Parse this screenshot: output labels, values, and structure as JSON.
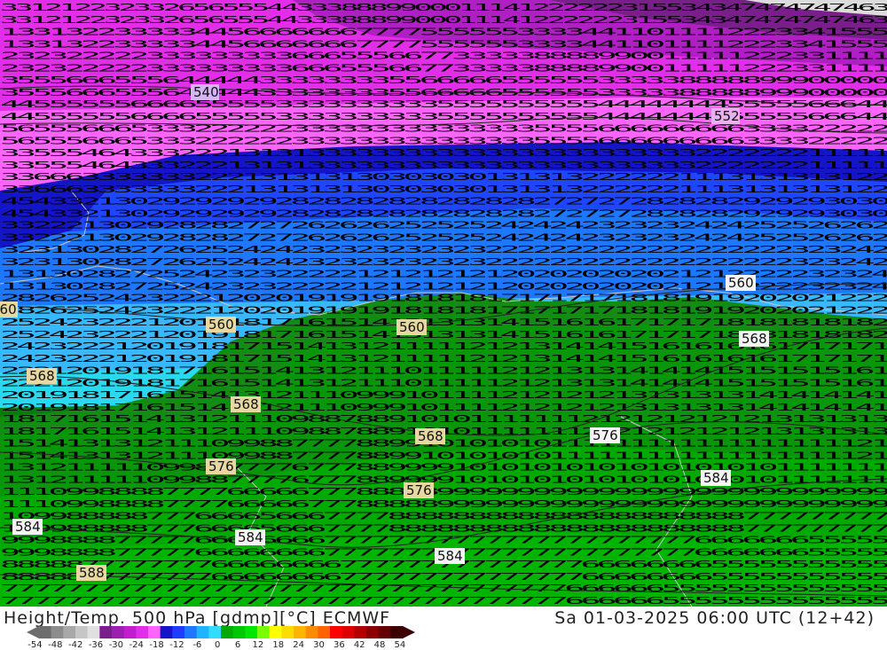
{
  "map": {
    "title": "Height/Temp. 500 hPa [gdmp][°C] ECMWF",
    "datetime": "Sa 01-03-2025 06:00 UTC (12+42)",
    "contour_labels": [
      "540",
      "552",
      "560",
      "560",
      "560",
      "560",
      "568",
      "568",
      "568",
      "568",
      "568",
      "576",
      "576",
      "576",
      "584",
      "584",
      "584",
      "584",
      "588"
    ],
    "grid_rows": [
      "33 1212 2323 32 6565 5 5 4 4 3 3 3 8 8 8 9 9 0 0 0 1 1 1 4 1 2 2 2 2 2 2 3 1 5 5 3 4 3 4 7 4 7 4 7 4 7 4 6 3",
      "1 3 3 1 3 2 2 3 3 3 3 3 4 4 5 6 6 6 6 6 6 6 7 7 7 7 5 5 5 5 5 5 3 3 3 3 4 4 1 1 0 1 1 1 1 2 2 2 3 3 4 1 5 5 5",
      "2 3 2 3 2 2 2 2 2 3 3 3 3 3 3 3 3 3 6 6 6 5 5 5 6 6 7 7 3 3 3 3 3 8 8 8 8 9 9 0 0 1 1 1 1 1 2 2 2 3 3 1 1 1 1",
      "3 5 5 5 6 6 6 5 5 5 6 4 4 4 4 4 3 3 3 3 3 3 3 3 5 5 6 6 6 6 6 5 5 5 5 5 5 3 3 3 3 3 8 8 8 8 8 9 9 9 0 0 0 0 0",
      "4 4 5 5 5 5 5 5 6 6 6 6 5 5 5 5 5 3 3 3 3 3 3 3 3 3 3 5 5 5 5 5 5 5 5 5 5 4 4 4 4 4 4 4 4 5 5 5 5 5 6 6 6 4 4",
      "5 6 5 5 5 6 6 6 5 3 3 3 2 2 2 2 2 2 3 3 3 3 3 3 3 3 3 3 3 3 3 3 3 5 5 5 5 6 6 6 6 6 6 6 6 6 3 3 3 3 2 2 2 2 2",
      "3 3 5 5 5 4 6 4 3 3 3 2 2 2 1 3 1 3 1 3 3 3 3 3 3 3 3 3 3 3 3 3 3 3 3 3 3 3 3 3 3 3 3 2 2 2 2 2 2 2 1 1 1 1 1",
      "3 3 6 6 6 3 3 3 3 3 3 3 2 2 2 1 3 1 3 1 3 1 3 0 3 0 3 0 3 0 1 3 1 3 1 3 2 2 2 2 2 2 1 1 1 3 1 3 1 3 1 3 1 2 2",
      "4 5 4 3 3 2 1 3 0 2 9 2 9 2 9 2 9 2 8 2 8 2 8 2 8 2 8 2 8 2 8 2 8 2 7 2 7 2 7 2 8 2 8 2 8 2 9 2 9 2 9 3 0 3 0",
      "3 3 2 2 2 1 3 0 2 9 2 8 2 8 2 7 2 7 2 6 2 6 2 6 2 5 2 5 2 5 2 4 2 4 2 4 2 3 2 3 2 3 2 4 2 4 2 5 2 5 2 6 2 6 2",
      "3 2 3 1 3 0 2 8 2 7 2 6 2 5 2 4 2 4 2 3 2 3 2 3 2 3 2 3 2 3 2 2 2 2 2 2 2 2 2 2 2 2 2 2 2 2 2 2 2 3 2 3 2 4 2",
      "1 3 1 3 0 2 8 2 7 2 5 2 4 2 3 2 3 2 2 2 2 2 1 2 1 2 1 2 1 2 1 2 0 2 0 2 0 2 0 2 0 2 1 2 1 2 2 2 2 2 3 2 3 2 4",
      "2 8 2 6 2 5 2 4 2 3 2 2 2 1 2 0 2 0 1 9 1 9 1 9 1 8 1 8 1 8 1 7 1 7 1 7 1 7 1 8 1 8 1 9 1 9 2 0 2 0 2 1 2 2 2",
      "2 5 2 4 2 3 2 2 2 1 2 0 1 9 1 8 1 7 1 6 1 5 1 4 1 3 1 3 1 3 1 4 1 5 1 6 1 6 1 7 1 7 1 7 1 8 1 8 1 8 1 8 1 8 2",
      "2 4 2 3 2 2 2 1 2 0 1 9 1 8 1 7 1 5 1 4 1 3 1 2 1 1 1 1 1 2 1 2 1 3 1 4 1 4 1 5 1 6 1 6 1 6 1 6 1 7 1 7 1 7 1",
      "2 2 2 1 2 0 1 9 1 8 1 7 1 6 1 5 1 4 1 3 1 2 1 1 1 0 1 1 1 1 1 2 1 2 1 3 1 3 1 4 1 4 1 4 1 5 1 5 1 5 1 5 1 6 1",
      "2 0 1 9 1 8 1 7 1 6 1 5 1 4 1 3 1 2 1 1 1 0 9 9 9 1 0 1 1 1 1 2 1 2 1 2 1 2 1 3 1 3 1 3 1 3 1 4 1 4 1 4 1 4 1",
      "1 8 1 7 1 6 1 5 1 4 1 3 1 2 1 1 1 0 9 8 8 7 8 8 9 1 0 1 0 1 1 1 1 1 1 1 2 1 2 1 2 1 2 1 2 1 2 1 3 1 3 1 3 1 3",
      "1 5 1 4 1 3 1 3 1 2 1 1 1 0 9 9 8 8 7 7 7 7 8 8 9 9 1 0 1 0 1 0 1 0 1 1 1 1 1 1 1 1 1 1 1 1 1 1 1 1 1 1 1 2 1",
      "1 3 1 2 1 1 1 1 1 0 9 9 8 8 7 7 7 7 6 7 7 7 8 8 9 9 9 9 1 0 1 0 1 0 1 0 1 0 1 0 1 0 1 0 1 0 1 0 1 1 1 1 1 1 1",
      "1 1 1 0 9 9 8 8 8 8 7 7 7 7 6 6 6 6 6 7 7 7 8 8 8 8 8 9 9 9 9 9 9 9 9 9 9 9 9 9 9 9 9 9 9 9 9 9 9 9 9 9 9 9 9",
      "1 0 9 9 8 8 8 8 8 7 7 7 6 6 6 6 5 6 6 6 7 7 7 7 8 8 8 8 8 8 8 8 8 8 8 8 8 8 8 8 8 8 8 8 8 8 7 7 7 7 7 7 7 7 7",
      "9 9 9 8 8 8 8 7 7 7 7 7 6 6 6 6 6 6 6 6 7 7 7 7 7 7 7 7 7 7 7 7 7 7 7 7 7 7 7 7 7 7 7 6 6 6 6 6 6 6 5 5 5 5 5",
      "8 8 8 8 8 7 7 7 7 7 7 7 7 6 6 6 6 6 6 6 6 7 7 7 7 7 7 7 7 7 7 7 7 7 7 7 6 6 6 6 6 6 6 6 5 5 5 5 5 5 5 5 5 5 5",
      "7 7 7 7 7 7 7 7 7 7 7 7 7 7 7 7 7 7 7 7 7 7 7 7 7 7 7 7 7 7 7 7 7 7 7 6 6 6 6 6 6 5 5 5 5 5 5 5 5 5 5 5 5 5 5"
    ]
  },
  "colorbar": {
    "ticks": [
      "-54",
      "-48",
      "-42",
      "-36",
      "-30",
      "-24",
      "-18",
      "-12",
      "-6",
      "0",
      "6",
      "12",
      "18",
      "24",
      "30",
      "36",
      "42",
      "48",
      "54"
    ],
    "colors": [
      "#6d6d6d",
      "#8c8c8c",
      "#a8a8a8",
      "#c6c6c6",
      "#e0e0e0",
      "#7a1e8c",
      "#9c1fb0",
      "#c21ed0",
      "#e22ee8",
      "#ff64ff",
      "#1414c8",
      "#1e3cff",
      "#1e78ff",
      "#1eb4ff",
      "#32dcff",
      "#00aa00",
      "#00c800",
      "#00e600",
      "#78ff00",
      "#ffff00",
      "#ffdc00",
      "#ffb400",
      "#ff8c00",
      "#ff6400",
      "#ff0000",
      "#dc0000",
      "#b40000",
      "#8c0000",
      "#640000",
      "#3c0000"
    ]
  }
}
